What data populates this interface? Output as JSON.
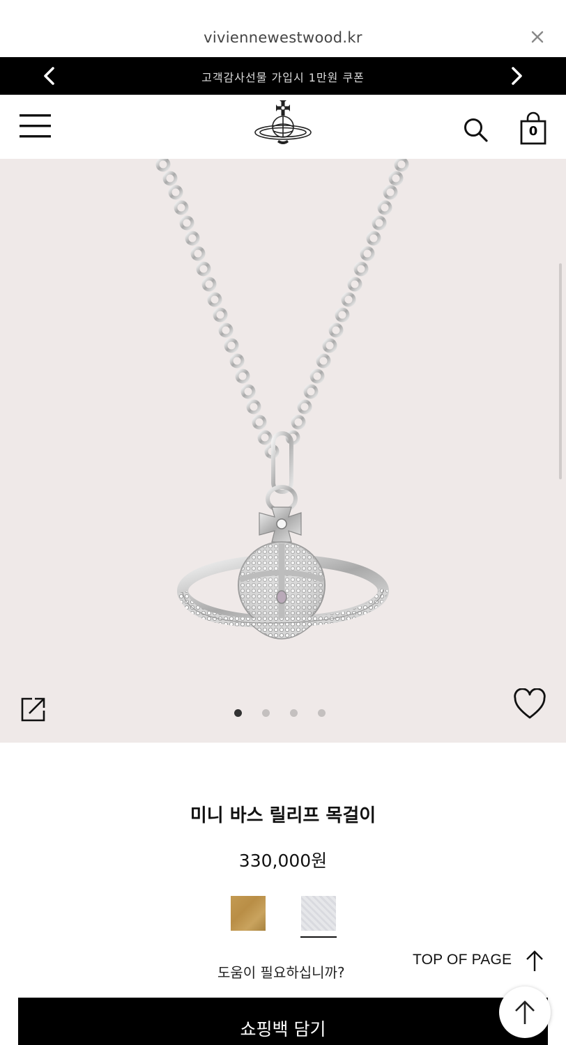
{
  "browser": {
    "url": "viviennewestwood.kr",
    "close_icon": "close-icon"
  },
  "promo": {
    "text": "고객감사선물 가입시 1만원 쿠폰",
    "prev_icon": "chevron-left-icon",
    "next_icon": "chevron-right-icon"
  },
  "header": {
    "menu_icon": "hamburger-menu-icon",
    "logo": "orb-logo",
    "search_icon": "search-icon",
    "bag_count": "0"
  },
  "gallery": {
    "image": "silver orb pendant necklace",
    "slide_count": 4,
    "active_slide": 1,
    "share_icon": "share-icon",
    "wishlist_icon": "heart-icon"
  },
  "product": {
    "name": "미니 바스 릴리프 목걸이",
    "price": "330,000원",
    "swatches": [
      {
        "name": "gold",
        "color": "#c39a52"
      },
      {
        "name": "silver",
        "color": "#e2e3e7",
        "selected": true
      }
    ],
    "help_text": "도움이 필요하십니까?"
  },
  "top_of_page": {
    "label": "TOP OF PAGE"
  },
  "add_to_bag": {
    "label": "쇼핑백 담기"
  },
  "colors": {
    "banner": "#000000",
    "gallery_bg": "#efe9e8",
    "button_bg": "#000000"
  }
}
